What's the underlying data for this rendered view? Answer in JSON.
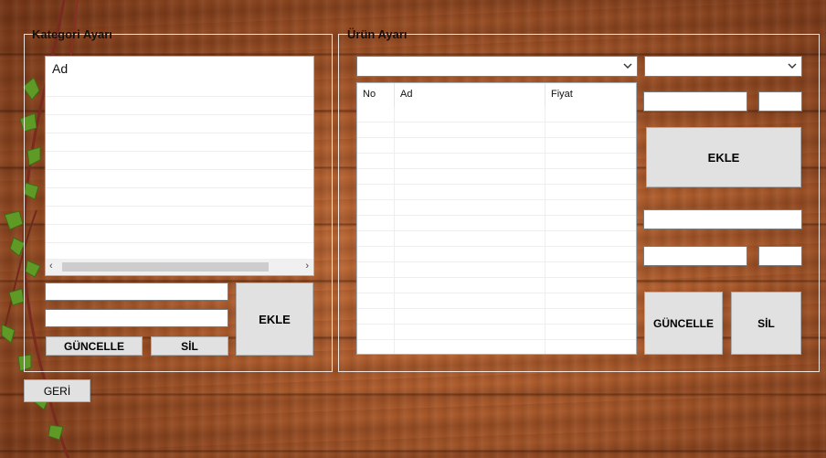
{
  "kategori": {
    "title": "Kategori Ayarı",
    "list_header": "Ad",
    "ekle_label": "EKLE",
    "guncelle_label": "GÜNCELLE",
    "sil_label": "SİL"
  },
  "urun": {
    "title": "Ürün Ayarı",
    "columns": [
      "No",
      "Ad",
      "Fiyat"
    ],
    "ekle_label": "EKLE",
    "guncelle_label": "GÜNCELLE",
    "sil_label": "SİL"
  },
  "geri_label": "GERİ",
  "colors": {
    "button_bg": "#e1e1e1",
    "wood": "#a85a2c",
    "leaf": "#6aa22a"
  }
}
